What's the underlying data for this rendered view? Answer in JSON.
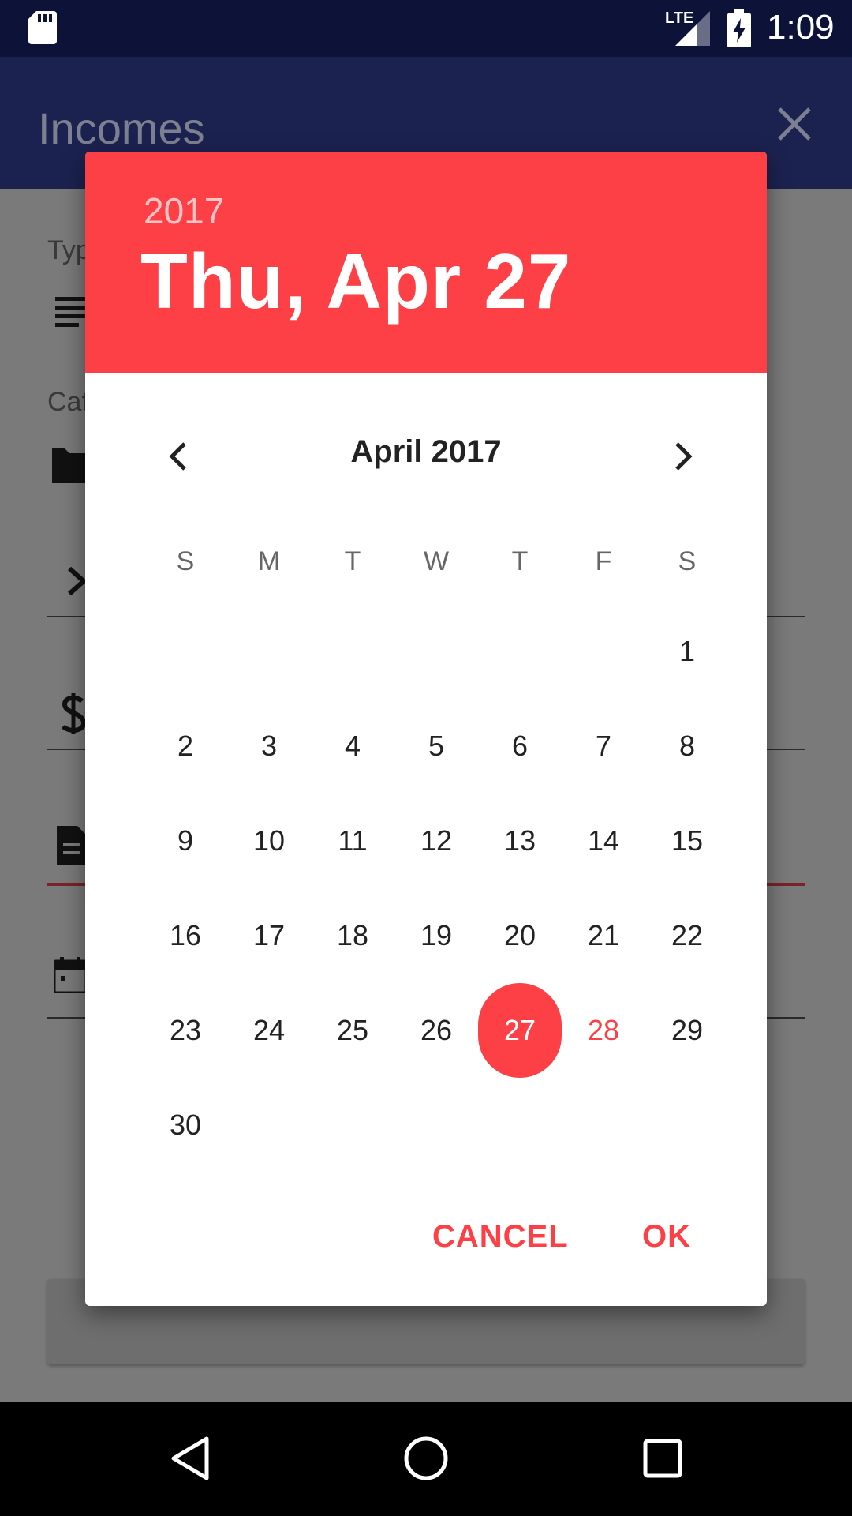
{
  "status_bar": {
    "network": "LTE",
    "time": "1:09",
    "icons": [
      "sd-card-icon",
      "signal-icon",
      "battery-charging-icon"
    ]
  },
  "app_bar": {
    "title": "Incomes",
    "close_icon": "close-icon"
  },
  "background_form": {
    "labels": [
      "Typ",
      "Cat"
    ]
  },
  "date_picker": {
    "year": "2017",
    "selected_date": "Thu, Apr 27",
    "month_label": "April 2017",
    "weekdays": [
      "S",
      "M",
      "T",
      "W",
      "T",
      "F",
      "S"
    ],
    "first_weekday_index": 6,
    "days": [
      "1",
      "2",
      "3",
      "4",
      "5",
      "6",
      "7",
      "8",
      "9",
      "10",
      "11",
      "12",
      "13",
      "14",
      "15",
      "16",
      "17",
      "18",
      "19",
      "20",
      "21",
      "22",
      "23",
      "24",
      "25",
      "26",
      "27",
      "28",
      "29",
      "30"
    ],
    "selected_day": "27",
    "today": "28",
    "cancel_label": "CANCEL",
    "ok_label": "OK",
    "accent_color": "#fd4045"
  },
  "nav_bar": {
    "icons": [
      "back-icon",
      "home-icon",
      "recents-icon"
    ]
  }
}
